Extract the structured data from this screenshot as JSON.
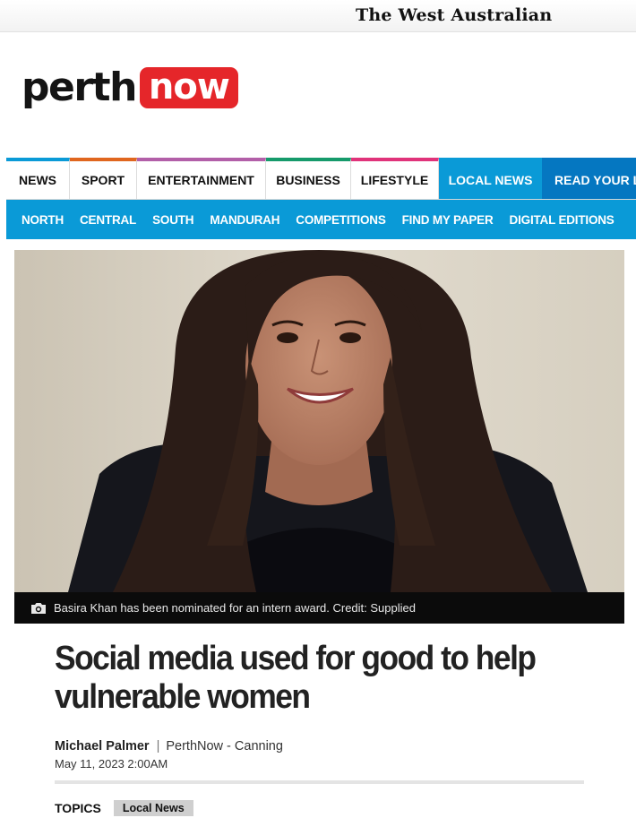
{
  "masthead": {
    "partner_logo_text": "The West Australian"
  },
  "logo": {
    "part1": "perth",
    "part2": "now"
  },
  "primary_nav": {
    "items": [
      {
        "label": "NEWS",
        "accent": "#0a9ad7"
      },
      {
        "label": "SPORT",
        "accent": "#e0661f"
      },
      {
        "label": "ENTERTAINMENT",
        "accent": "#b25fa8"
      },
      {
        "label": "BUSINESS",
        "accent": "#169a6b"
      },
      {
        "label": "LIFESTYLE",
        "accent": "#e0337a"
      },
      {
        "label": "LOCAL NEWS",
        "accent": "#0a9ad7"
      },
      {
        "label": "READ YOUR LO",
        "accent": "#0577c1"
      }
    ]
  },
  "secondary_nav": {
    "items": [
      "NORTH",
      "CENTRAL",
      "SOUTH",
      "MANDURAH",
      "COMPETITIONS",
      "FIND MY PAPER",
      "DIGITAL EDITIONS"
    ]
  },
  "hero": {
    "caption": "Basira Khan has been nominated for an intern award. Credit: Supplied",
    "camera_icon": "camera-icon"
  },
  "article": {
    "headline": "Social media used for good to help vulnerable women",
    "author": "Michael Palmer",
    "separator": "|",
    "source": "PerthNow - Canning",
    "date": "May 11, 2023 2:00AM"
  },
  "topics": {
    "label": "TOPICS",
    "tags": [
      "Local News"
    ]
  },
  "colors": {
    "brand_red": "#e5262a",
    "nav_blue": "#0a9ad7",
    "nav_dark_blue": "#0577c1"
  }
}
